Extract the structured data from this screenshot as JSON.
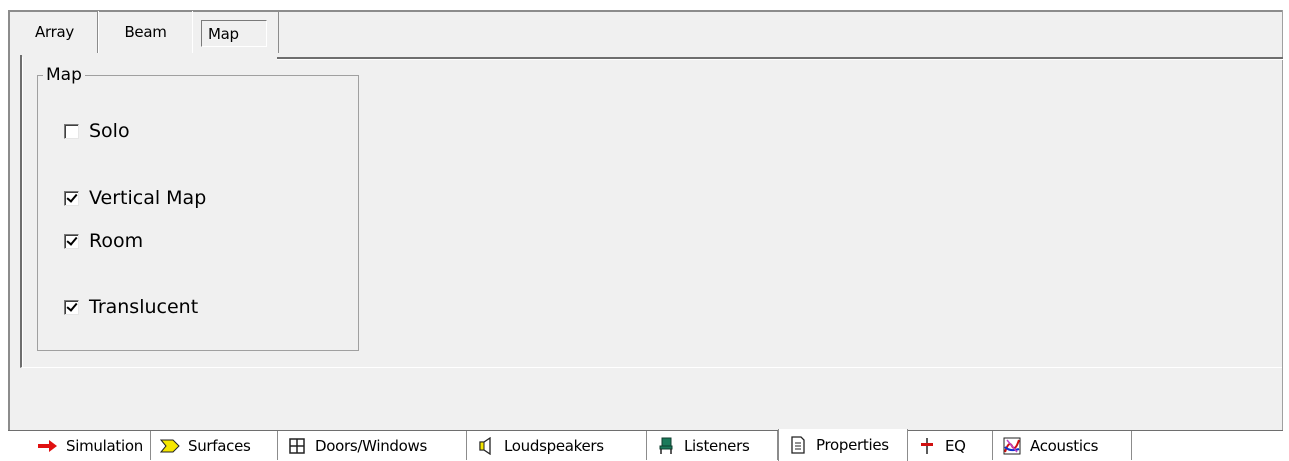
{
  "top_tabs": [
    {
      "label": "Array"
    },
    {
      "label": "Beam"
    },
    {
      "label": "Map",
      "selected": true
    }
  ],
  "group": {
    "title": "Map",
    "options": [
      {
        "label": "Solo",
        "checked": false
      },
      {
        "label": "Vertical Map",
        "checked": true
      },
      {
        "label": "Room",
        "checked": true
      },
      {
        "label": "Translucent",
        "checked": true
      }
    ]
  },
  "bottom_tabs": [
    {
      "label": "Simulation",
      "icon": "red-arrow-icon"
    },
    {
      "label": "Surfaces",
      "icon": "surface-icon"
    },
    {
      "label": "Doors/Windows",
      "icon": "window-grid-icon"
    },
    {
      "label": "Loudspeakers",
      "icon": "loudspeaker-icon"
    },
    {
      "label": "Listeners",
      "icon": "chair-icon"
    },
    {
      "label": "Properties",
      "icon": "document-icon",
      "selected": true
    },
    {
      "label": "EQ",
      "icon": "eq-icon"
    },
    {
      "label": "Acoustics",
      "icon": "acoustics-icon"
    }
  ],
  "colors": {
    "panel": "#f0f0f0",
    "accent_red": "#e01010",
    "surface_yellow": "#f5e600"
  }
}
